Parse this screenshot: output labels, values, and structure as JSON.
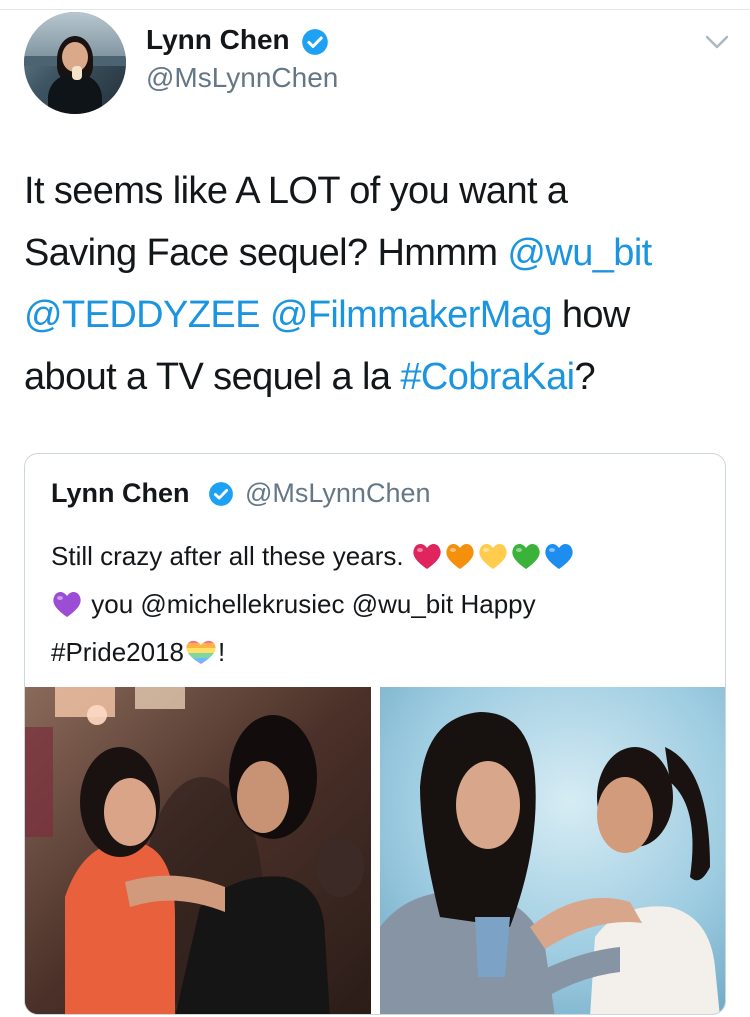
{
  "author": {
    "name": "Lynn Chen",
    "handle": "@MsLynnChen"
  },
  "tweet": {
    "lines": [
      [
        {
          "t": "It seems like A LOT of you want a",
          "k": "text"
        }
      ],
      [
        {
          "t": "Saving Face sequel? Hmmm ",
          "k": "text"
        },
        {
          "t": "@wu_bit",
          "k": "mention"
        }
      ],
      [
        {
          "t": "@TEDDYZEE",
          "k": "mention"
        },
        {
          "t": " ",
          "k": "text"
        },
        {
          "t": "@FilmmakerMag",
          "k": "mention"
        },
        {
          "t": " how",
          "k": "text"
        }
      ],
      [
        {
          "t": "about a TV sequel a la ",
          "k": "text"
        },
        {
          "t": "#CobraKai",
          "k": "hashtag"
        },
        {
          "t": "?",
          "k": "text"
        }
      ]
    ]
  },
  "quoted_tweet": {
    "name": "Lynn Chen",
    "handle": "@MsLynnChen",
    "line1": "Still crazy after all these years.",
    "line2": "you @michellekrusiec @wu_bit Happy",
    "line3_tag": "#Pride2018",
    "line3_end": "!",
    "hearts_line1": [
      "#e0245e",
      "#f4900c",
      "#ffcc4d",
      "#3bb33b",
      "#1d8ef0"
    ],
    "heart_line2": "#9b4dd6",
    "media": [
      {
        "name": "movie-still-photo"
      },
      {
        "name": "portrait-photo"
      }
    ]
  },
  "colors": {
    "link": "#1b95e0",
    "verified": "#1da1f2",
    "secondary_text": "#657786"
  }
}
